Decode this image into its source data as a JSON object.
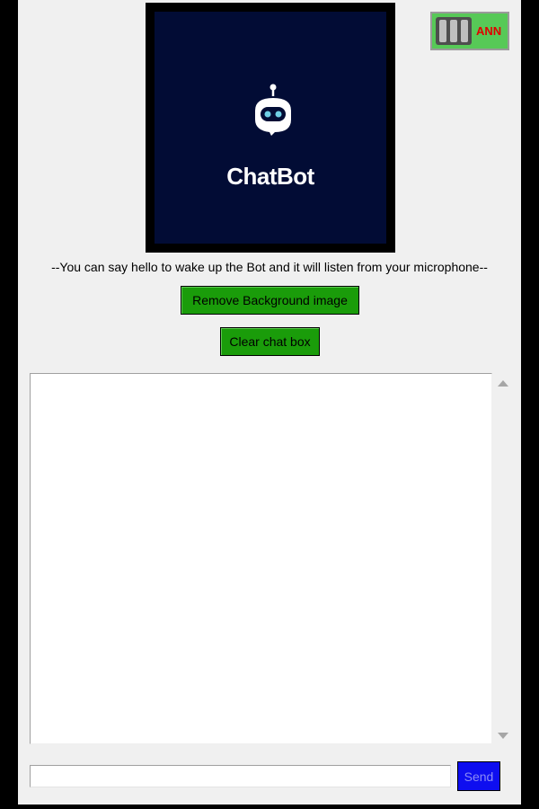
{
  "logo": {
    "word": "ChatBot",
    "icon": "robot-head-icon",
    "background_color": "#020c35"
  },
  "toggle": {
    "label": "ANN",
    "icon": "mode-toggle-icon"
  },
  "hint_text": "--You can say hello to wake up the Bot and it will listen from your microphone--",
  "buttons": {
    "remove_bg": "Remove Background image",
    "clear_chat": "Clear chat box",
    "send": "Send"
  },
  "chat": {
    "content": ""
  },
  "message_input": {
    "value": ""
  },
  "colors": {
    "button_green": "#1a9c0a",
    "send_blue": "#0e0ef0",
    "toggle_green": "#57c957",
    "toggle_text": "#e00000"
  }
}
